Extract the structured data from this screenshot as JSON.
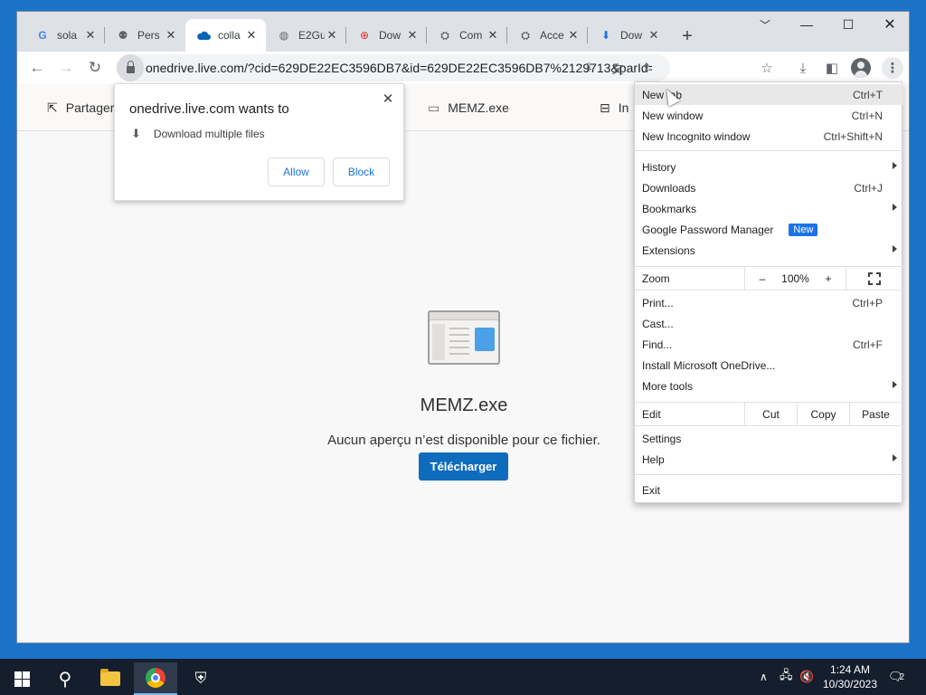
{
  "browser": {
    "tabs": [
      {
        "title": "sola",
        "icon": "google-icon"
      },
      {
        "title": "Pers",
        "icon": "onedrive-person-icon"
      },
      {
        "title": "colla",
        "icon": "onedrive-cloud-icon",
        "active": true
      },
      {
        "title": "E2Gu",
        "icon": "globe-icon"
      },
      {
        "title": "Dow",
        "icon": "target-icon"
      },
      {
        "title": "Com",
        "icon": "kali-icon"
      },
      {
        "title": "Acce",
        "icon": "kali-icon"
      },
      {
        "title": "Dow",
        "icon": "download-icon"
      }
    ],
    "address": "onedrive.live.com/?cid=629DE22EC3596DB7&id=629DE22EC3596DB7%2129713&parId=6..."
  },
  "page": {
    "commands": [
      "Partager",
      "MEMZ.exe",
      "In"
    ],
    "file_name": "MEMZ.exe",
    "no_preview_text": "Aucun aperçu n’est disponible pour ce fichier.",
    "download_button": "Télécharger"
  },
  "permission_popup": {
    "title": "onedrive.live.com wants to",
    "item": "Download multiple files",
    "allow": "Allow",
    "block": "Block"
  },
  "menu": {
    "new_tab": {
      "label": "New tab",
      "shortcut": "Ctrl+T"
    },
    "new_window": {
      "label": "New window",
      "shortcut": "Ctrl+N"
    },
    "new_incognito": {
      "label": "New Incognito window",
      "shortcut": "Ctrl+Shift+N"
    },
    "history": {
      "label": "History"
    },
    "downloads": {
      "label": "Downloads",
      "shortcut": "Ctrl+J"
    },
    "bookmarks": {
      "label": "Bookmarks"
    },
    "password_manager": {
      "label": "Google Password Manager",
      "badge": "New"
    },
    "extensions": {
      "label": "Extensions"
    },
    "zoom": {
      "label": "Zoom",
      "minus": "–",
      "value": "100%",
      "plus": "+"
    },
    "print": {
      "label": "Print...",
      "shortcut": "Ctrl+P"
    },
    "cast": {
      "label": "Cast..."
    },
    "find": {
      "label": "Find...",
      "shortcut": "Ctrl+F"
    },
    "install": {
      "label": "Install Microsoft OneDrive..."
    },
    "more_tools": {
      "label": "More tools"
    },
    "edit": {
      "label": "Edit",
      "cut": "Cut",
      "copy": "Copy",
      "paste": "Paste"
    },
    "settings": {
      "label": "Settings"
    },
    "help": {
      "label": "Help"
    },
    "exit": {
      "label": "Exit"
    }
  },
  "taskbar": {
    "time": "1:24 AM",
    "date": "10/30/2023",
    "notification_count": "2"
  }
}
